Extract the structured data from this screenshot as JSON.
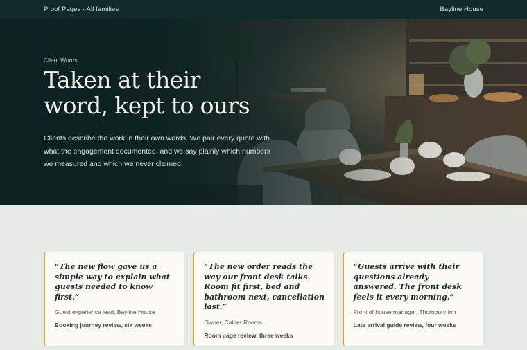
{
  "nav": {
    "brand": "Proof Pages · All families",
    "client": "Bayline House"
  },
  "hero": {
    "eyebrow": "Client Words",
    "title_line1": "Taken at their",
    "title_line2": "word, kept to ours",
    "description": "Clients describe the work in their own words. We pair every quote with what the engagement documented, and we say plainly which numbers we measured and which we never claimed."
  },
  "testimonials": [
    {
      "quote": "“The new flow gave us a simple way to explain what guests needed to know first.”",
      "author": "Guest experience lead, Bayline House",
      "project": "Booking journey review, six weeks"
    },
    {
      "quote": "“The new order reads the way our front desk talks. Room fit first, bed and bathroom next, cancellation last.”",
      "author": "Owner, Calder Rooms",
      "project": "Room page review, three weeks"
    },
    {
      "quote": "“Guests arrive with their questions already answered. The front desk feels it every morning.”",
      "author": "Front of house manager, Thornbury Inn",
      "project": "Late arrival guide review, four weeks"
    }
  ],
  "colors": {
    "nav_bg": "#0f2a2a",
    "page_bg": "#e6ebe6",
    "card_bg": "#fcfaf4",
    "card_accent": "#cfa74a"
  }
}
